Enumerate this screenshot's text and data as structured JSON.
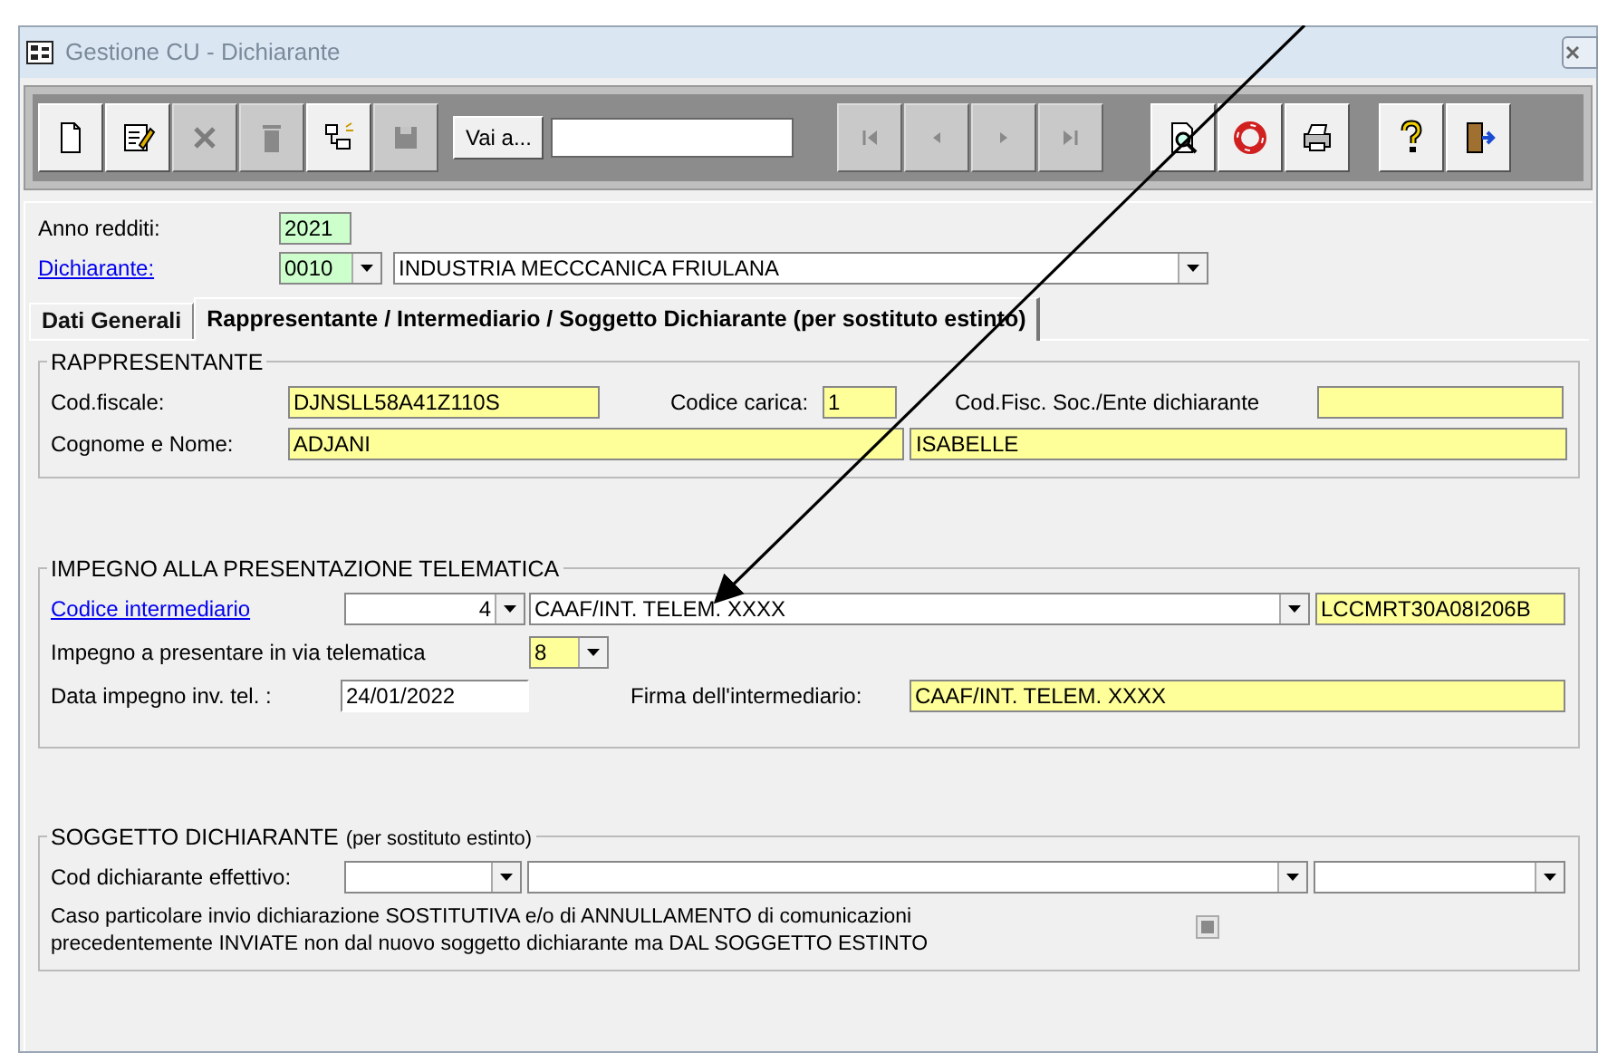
{
  "window": {
    "title": "Gestione CU - Dichiarante"
  },
  "toolbar": {
    "buttons": [
      {
        "kind": "new",
        "disabled": false
      },
      {
        "kind": "edit",
        "disabled": false
      },
      {
        "kind": "cancel",
        "disabled": true
      },
      {
        "kind": "delete",
        "disabled": true
      },
      {
        "kind": "copy",
        "disabled": false
      },
      {
        "kind": "save",
        "disabled": true
      }
    ],
    "goto_label": "Vai a...",
    "nav_buttons": [
      {
        "kind": "first",
        "disabled": true
      },
      {
        "kind": "prev",
        "disabled": true
      },
      {
        "kind": "next",
        "disabled": true
      },
      {
        "kind": "last",
        "disabled": true
      }
    ],
    "tool_buttons": [
      {
        "kind": "preview",
        "disabled": false
      },
      {
        "kind": "refresh",
        "disabled": false
      },
      {
        "kind": "print",
        "disabled": false
      }
    ],
    "end_buttons": [
      {
        "kind": "help",
        "disabled": false
      },
      {
        "kind": "exit",
        "disabled": false
      }
    ]
  },
  "header": {
    "anno_label": "Anno redditi:",
    "anno_value": "2021",
    "dichiarante_label": "Dichiarante:",
    "dichiarante_code": "0010",
    "dichiarante_name": "INDUSTRIA  MECCCANICA FRIULANA"
  },
  "tabs": [
    {
      "label": "Dati Generali",
      "selected": false
    },
    {
      "label": "Rappresentante / Intermediario / Soggetto Dichiarante (per sostituto estinto)",
      "selected": true
    }
  ],
  "rappresentante": {
    "title": "RAPPRESENTANTE",
    "cod_fiscale_label": "Cod.fiscale:",
    "cod_fiscale": "DJNSLL58A41Z110S",
    "codice_carica_label": "Codice carica:",
    "codice_carica": "1",
    "cod_fisc_soc_label": "Cod.Fisc. Soc./Ente dichiarante",
    "cognome_nome_label": "Cognome e Nome:",
    "cognome": "ADJANI",
    "nome": "ISABELLE"
  },
  "impegno": {
    "title": "IMPEGNO ALLA PRESENTAZIONE TELEMATICA",
    "codice_label": "Codice intermediario",
    "codice": "4",
    "intermediario": "CAAF/INT. TELEM. XXXX",
    "intermediario_cf": "LCCMRT30A08I206B",
    "impegno_label": "Impegno a presentare in via telematica",
    "impegno_value": "8",
    "data_label": "Data impegno inv. tel. :",
    "data_value": "24/01/2022",
    "firma_label": "Firma dell'intermediario:",
    "firma_value": "CAAF/INT. TELEM. XXXX"
  },
  "soggetto": {
    "title": "SOGGETTO DICHIARANTE",
    "title_note": "(per sostituto estinto)",
    "cod_label": "Cod dichiarante effettivo:",
    "caso_text": "Caso particolare invio dichiarazione SOSTITUTIVA e/o di ANNULLAMENTO di comunicazioni precedentemente INVIATE non dal nuovo soggetto dichiarante ma DAL SOGGETTO ESTINTO",
    "caso_checked": true,
    "caso_disabled": true
  }
}
